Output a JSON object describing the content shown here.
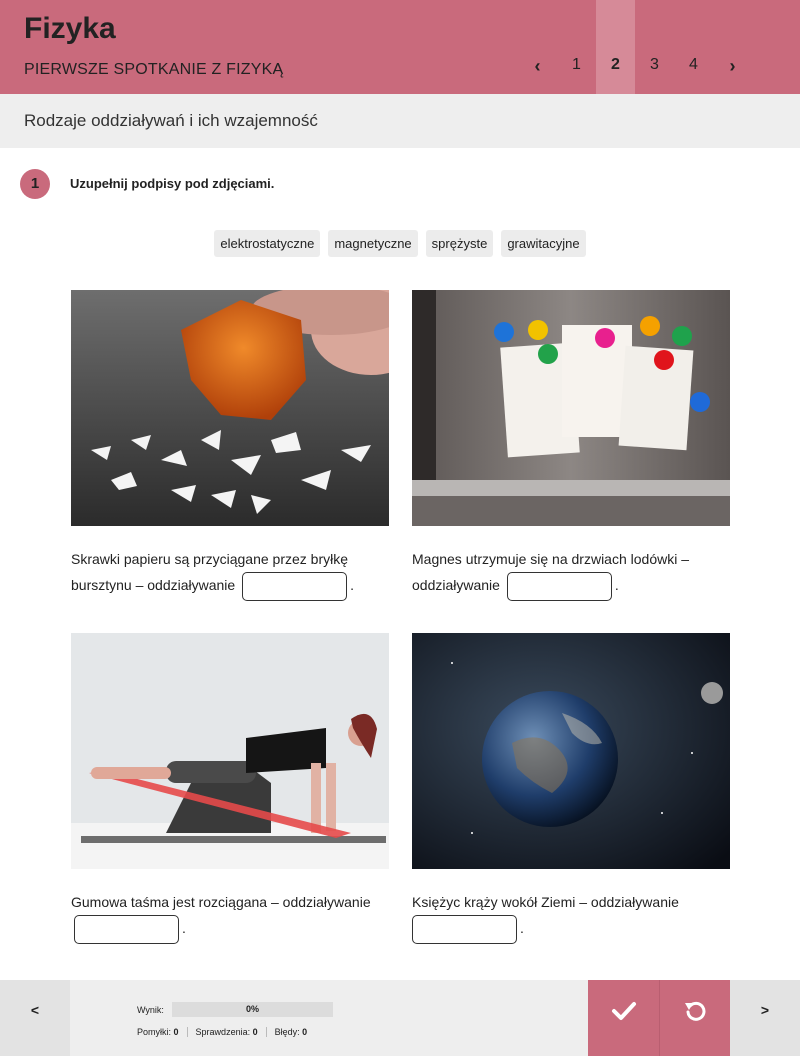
{
  "header": {
    "app_title": "Fizyka",
    "chapter": "PIERWSZE SPOTKANIE Z FIZYKĄ",
    "pages": [
      "1",
      "2",
      "3",
      "4"
    ],
    "active_page": "2",
    "prev_label": "‹",
    "next_label": "›"
  },
  "subheader": {
    "title": "Rodzaje oddziaływań i ich wzajemność"
  },
  "exercise": {
    "number": "1",
    "instruction": "Uzupełnij podpisy pod zdjęciami.",
    "word_bank": [
      "elektrostatyczne",
      "magnetyczne",
      "sprężyste",
      "grawitacyjne"
    ],
    "cards": [
      {
        "image": "amber-paper-photo",
        "before": "Skrawki papieru są przyciągane przez bryłkę bursztynu – oddziaływanie",
        "after": "."
      },
      {
        "image": "fridge-magnets-photo",
        "before": "Magnes utrzymuje się na drzwiach lodówki – oddziaływanie",
        "after": "."
      },
      {
        "image": "resistance-band-photo",
        "before": "Gumowa taśma jest rozciągana – oddziaływanie",
        "after": "."
      },
      {
        "image": "earth-moon-photo",
        "before": "Księżyc krąży wokół Ziemi – oddziaływanie",
        "after": "."
      }
    ]
  },
  "footer": {
    "prev_label": "<",
    "next_label": ">",
    "score_label": "Wynik:",
    "score_value": "0%",
    "score_fraction": 0,
    "mistakes_label": "Pomyłki:",
    "mistakes_value": "0",
    "checks_label": "Sprawdzenia:",
    "checks_value": "0",
    "errors_label": "Błędy:",
    "errors_value": "0",
    "check_icon": "check-icon",
    "reset_icon": "reset-icon"
  },
  "colors": {
    "accent": "#c96a7c",
    "accent_light": "#d68a98",
    "panel": "#eeeeee"
  }
}
